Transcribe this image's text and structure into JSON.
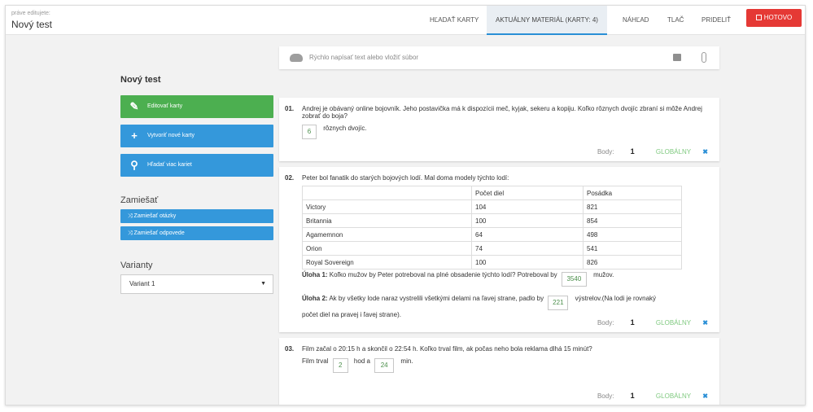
{
  "header": {
    "editing_label": "práve editujete:",
    "title": "Nový test",
    "tabs": [
      {
        "label": "HĽADAŤ KARTY"
      },
      {
        "label": "AKTUÁLNY MATERIÁL (KARTY: 4)"
      },
      {
        "label": "NÁHĽAD"
      },
      {
        "label": "TLAČ"
      },
      {
        "label": "PRIDELIŤ"
      }
    ],
    "done_label": "HOTOVO"
  },
  "sidebar": {
    "title": "Nový test",
    "edit_cards": "Editovať karty",
    "create_cards": "Vytvoriť nové karty",
    "search_cards": "Hľadať viac kariet",
    "shuffle_title": "Zamiešať",
    "shuffle_questions": "Zamiešať otázky",
    "shuffle_answers": "Zamiešať odpovede",
    "variants_title": "Varianty",
    "variant_selected": "Variant 1"
  },
  "quick_input": {
    "placeholder": "Rýchlo napísať text alebo vložiť súbor"
  },
  "footer_labels": {
    "points_label": "Body:",
    "global_label": "GLOBÁLNY"
  },
  "cards": [
    {
      "num": "01.",
      "text": "Andrej je obávaný online bojovník. Jeho postavička má k dispozícii meč, kyjak, sekeru a kopiju. Koľko rôznych dvojíc zbraní si môže Andrej zobrať do boja?",
      "answer": "6",
      "answer_suffix": "rôznych dvojíc.",
      "points": "1"
    },
    {
      "num": "02.",
      "text": "Peter bol fanatik do starých bojových lodí. Mal doma modely týchto lodí:",
      "table": {
        "headers": [
          "",
          "Počet diel",
          "Posádka"
        ],
        "rows": [
          [
            "Victory",
            "104",
            "821"
          ],
          [
            "Britannia",
            "100",
            "854"
          ],
          [
            "Agamemnon",
            "64",
            "498"
          ],
          [
            "Orion",
            "74",
            "541"
          ],
          [
            "Royal Sovereign",
            "100",
            "826"
          ]
        ]
      },
      "task1_label": "Úloha 1:",
      "task1_text": "Koľko mužov by Peter potreboval na plné obsadenie týchto lodí? Potreboval by",
      "task1_answer": "3540",
      "task1_suffix": "mužov.",
      "task2_label": "Úloha 2:",
      "task2_text": "Ak by všetky lode naraz vystrelili všetkými delami na ľavej strane, padlo by",
      "task2_answer": "221",
      "task2_suffix": "výstrelov.(Na lodi je rovnaký",
      "task2_line2": "počet diel na pravej i ľavej strane).",
      "points": "1"
    },
    {
      "num": "03.",
      "text": "Film začal o 20:15 h a skončil o 22:54 h. Koľko trval film, ak počas neho bola reklama dlhá 15 minút?",
      "prefix": "Film trval",
      "hours": "2",
      "hours_label": "hod a",
      "minutes": "24",
      "minutes_label": "min.",
      "points": "1"
    }
  ]
}
